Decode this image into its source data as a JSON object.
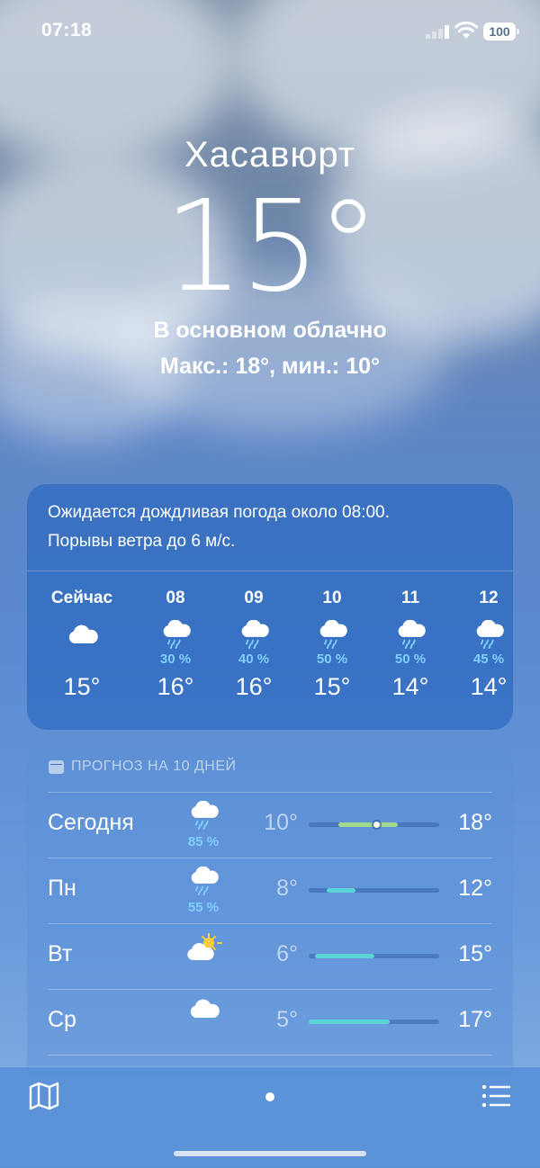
{
  "status_bar": {
    "time": "07:18",
    "battery": "100"
  },
  "location": {
    "city": "Хасавюрт",
    "temperature": "15°",
    "condition": "В основном облачно",
    "hi_lo": "Макс.: 18°, мин.: 10°"
  },
  "hourly": {
    "summary_line1": "Ожидается дождливая погода около 08:00.",
    "summary_line2": "Порывы ветра до 6 м/с.",
    "items": [
      {
        "label": "Сейчас",
        "icon": "cloud-icon",
        "precip": "",
        "temp": "15°"
      },
      {
        "label": "08",
        "icon": "cloud-rain-icon",
        "precip": "30 %",
        "temp": "16°"
      },
      {
        "label": "09",
        "icon": "cloud-rain-icon",
        "precip": "40 %",
        "temp": "16°"
      },
      {
        "label": "10",
        "icon": "cloud-rain-icon",
        "precip": "50 %",
        "temp": "15°"
      },
      {
        "label": "11",
        "icon": "cloud-rain-icon",
        "precip": "50 %",
        "temp": "14°"
      },
      {
        "label": "12",
        "icon": "cloud-rain-icon",
        "precip": "45 %",
        "temp": "14°"
      }
    ]
  },
  "daily": {
    "header": "ПРОГНОЗ НА 10 ДНЕЙ",
    "items": [
      {
        "day": "Сегодня",
        "icon": "cloud-rain-icon",
        "precip": "85 %",
        "low": "10°",
        "high": "18°",
        "range_start": 0.23,
        "range_end": 0.68,
        "current": 0.52
      },
      {
        "day": "Пн",
        "icon": "cloud-rain-icon",
        "precip": "55 %",
        "low": "8°",
        "high": "12°",
        "range_start": 0.14,
        "range_end": 0.36
      },
      {
        "day": "Вт",
        "icon": "partly-cloudy-sun-icon",
        "precip": "",
        "low": "6°",
        "high": "15°",
        "range_start": 0.05,
        "range_end": 0.5
      },
      {
        "day": "Ср",
        "icon": "cloud-icon",
        "precip": "",
        "low": "5°",
        "high": "17°",
        "range_start": 0.0,
        "range_end": 0.62
      }
    ]
  },
  "colors": {
    "precip": "#7fd0ff",
    "bar_green": "#9ed98c",
    "bar_teal": "#5bd3d6"
  }
}
